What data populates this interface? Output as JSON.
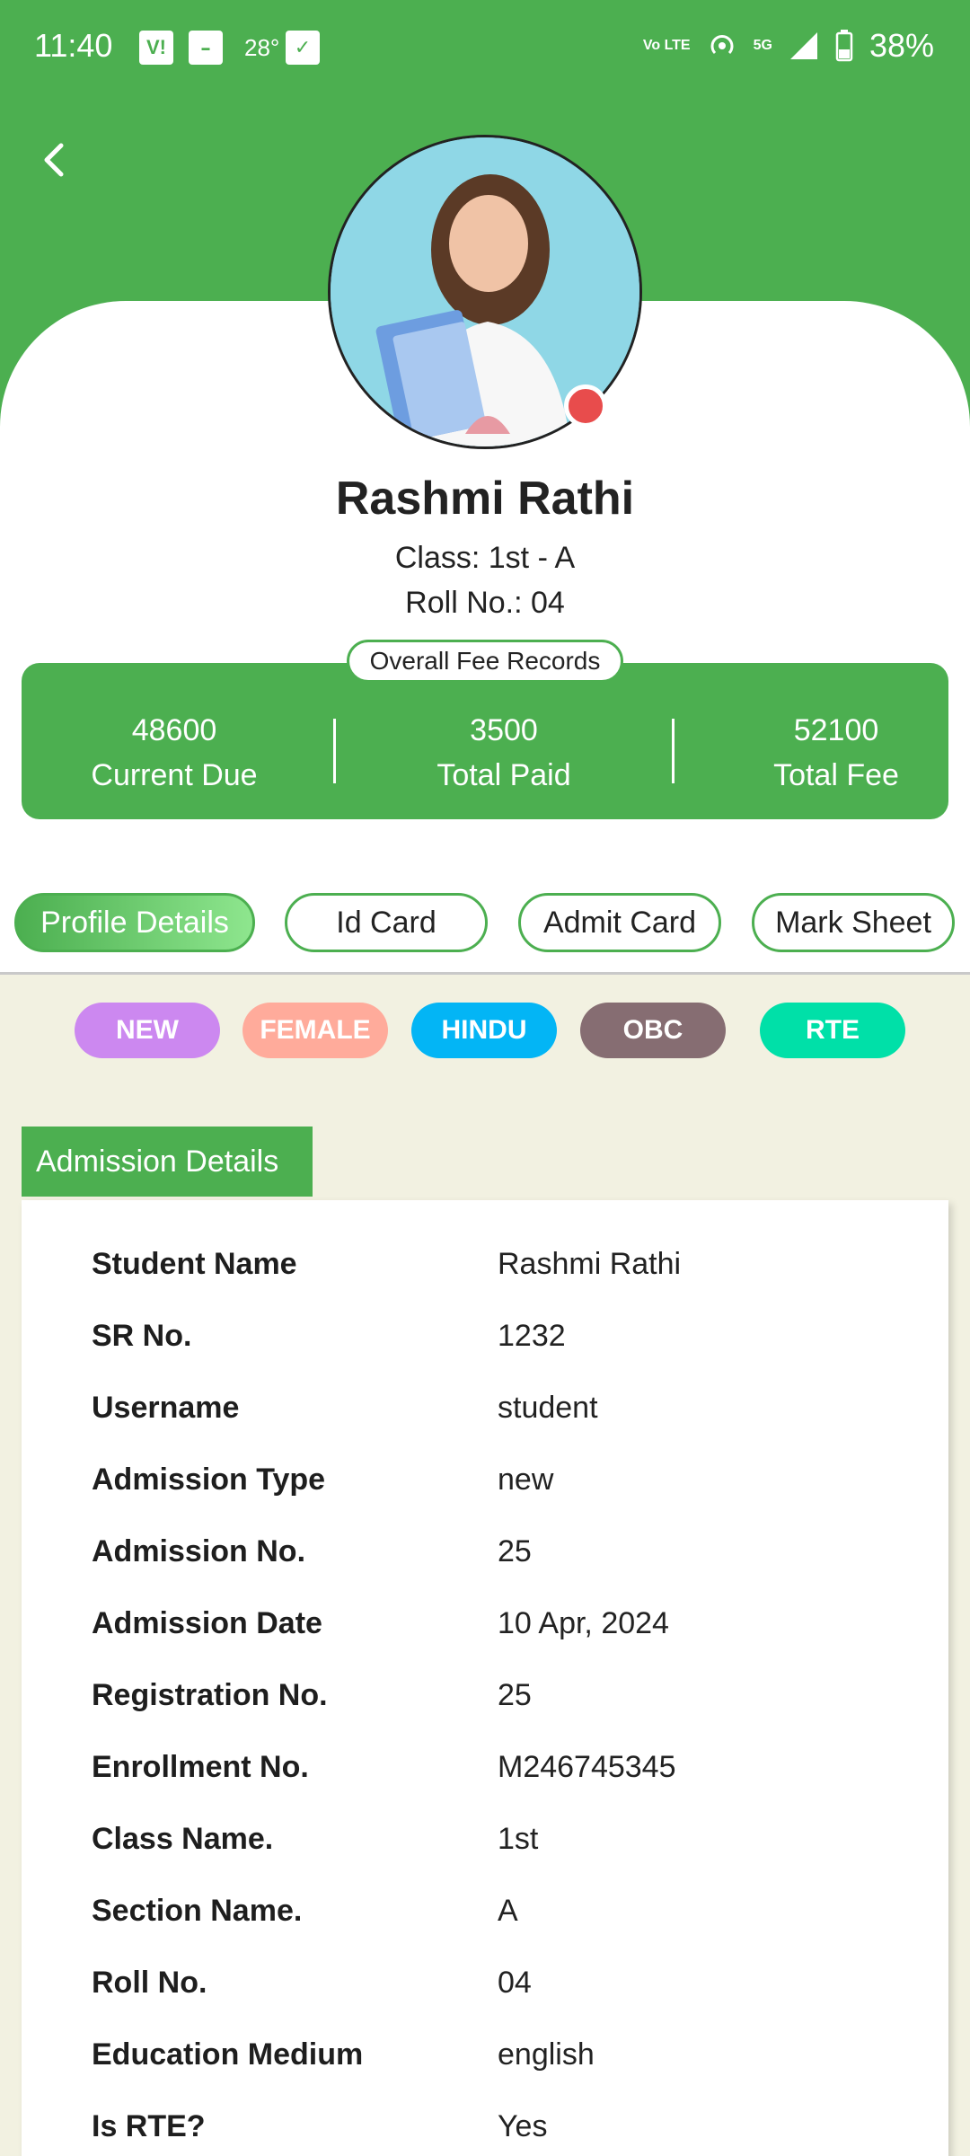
{
  "status_bar": {
    "time": "11:40",
    "temp": "28°",
    "network": "5G",
    "volte": "Vo LTE",
    "battery": "38%"
  },
  "profile": {
    "name": "Rashmi Rathi",
    "class_line": "Class: 1st - A",
    "roll_line": "Roll No.: 04"
  },
  "fee": {
    "label": "Overall Fee Records",
    "current_due": "48600",
    "current_due_label": "Current Due",
    "total_paid": "3500",
    "total_paid_label": "Total Paid",
    "total_fee": "52100",
    "total_fee_label": "Total Fee"
  },
  "tabs": [
    {
      "label": "Profile Details"
    },
    {
      "label": "Id Card"
    },
    {
      "label": "Admit Card"
    },
    {
      "label": "Mark Sheet"
    }
  ],
  "tags": [
    {
      "label": "NEW",
      "color": "#cc88f0"
    },
    {
      "label": "FEMALE",
      "color": "#ffab9b"
    },
    {
      "label": "HINDU",
      "color": "#03b5f5"
    },
    {
      "label": "OBC",
      "color": "#866d72"
    },
    {
      "label": "RTE",
      "color": "#00e0a8"
    }
  ],
  "admission": {
    "title": "Admission Details",
    "rows": [
      {
        "k": "Student Name",
        "v": "Rashmi Rathi"
      },
      {
        "k": "SR No.",
        "v": "1232"
      },
      {
        "k": "Username",
        "v": "student"
      },
      {
        "k": "Admission Type",
        "v": "new"
      },
      {
        "k": "Admission No.",
        "v": "25"
      },
      {
        "k": "Admission Date",
        "v": "10 Apr, 2024"
      },
      {
        "k": "Registration No.",
        "v": "25"
      },
      {
        "k": "Enrollment No.",
        "v": "M246745345"
      },
      {
        "k": "Class Name.",
        "v": "1st"
      },
      {
        "k": "Section Name.",
        "v": "A"
      },
      {
        "k": "Roll No.",
        "v": "04"
      },
      {
        "k": "Education Medium",
        "v": "english"
      },
      {
        "k": "Is RTE?",
        "v": "Yes"
      }
    ]
  }
}
